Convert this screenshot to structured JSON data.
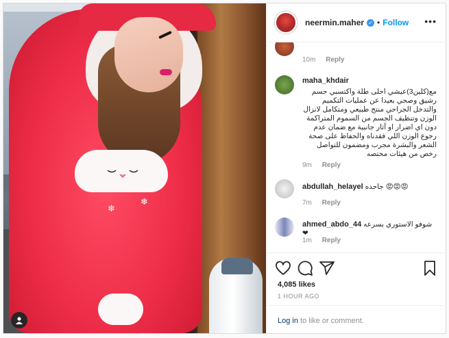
{
  "post": {
    "username": "neermin.maher",
    "separator": "•",
    "follow_label": "Follow",
    "more_label": "•••",
    "verified_icon": "verified-badge-icon",
    "accent_color": "#0095f6"
  },
  "comments": [
    {
      "username": "",
      "text": "",
      "time": "10m",
      "reply": "Reply"
    },
    {
      "username": "maha_khdair",
      "text": "مع(كلين3)عيشي احلى طلة واكتسبي جسم رشيق وصحي بعيدا عن عمليات التكميم والتدخل الجراحي منتج طبيعي ومتكامل لانزال الوزن وتنظيف الجسم من السموم المتراكمة دون اي اضرار او آثار جانبية مع ضمان عدم رجوع الوزن اللي فقدناه والحفاظ على صحة الشعر والبشرة مجرب ومضمون للتواصل رخص من هيئات مختصه",
      "time": "9m",
      "reply": "Reply"
    },
    {
      "username": "abdullah_helayel",
      "text": "جاحده 😡😡😡",
      "time": "7m",
      "reply": "Reply"
    },
    {
      "username": "ahmed_abdo_44",
      "text": "شوفو الاستوري بسرعه ❤",
      "time": "1m",
      "reply": "Reply"
    }
  ],
  "stats": {
    "likes": "4,085 likes",
    "time_ago": "1 HOUR AGO"
  },
  "login": {
    "link": "Log in",
    "rest": " to like or comment."
  },
  "icons": [
    "heart-icon",
    "comment-icon",
    "share-icon",
    "bookmark-icon",
    "user-tag-icon"
  ]
}
